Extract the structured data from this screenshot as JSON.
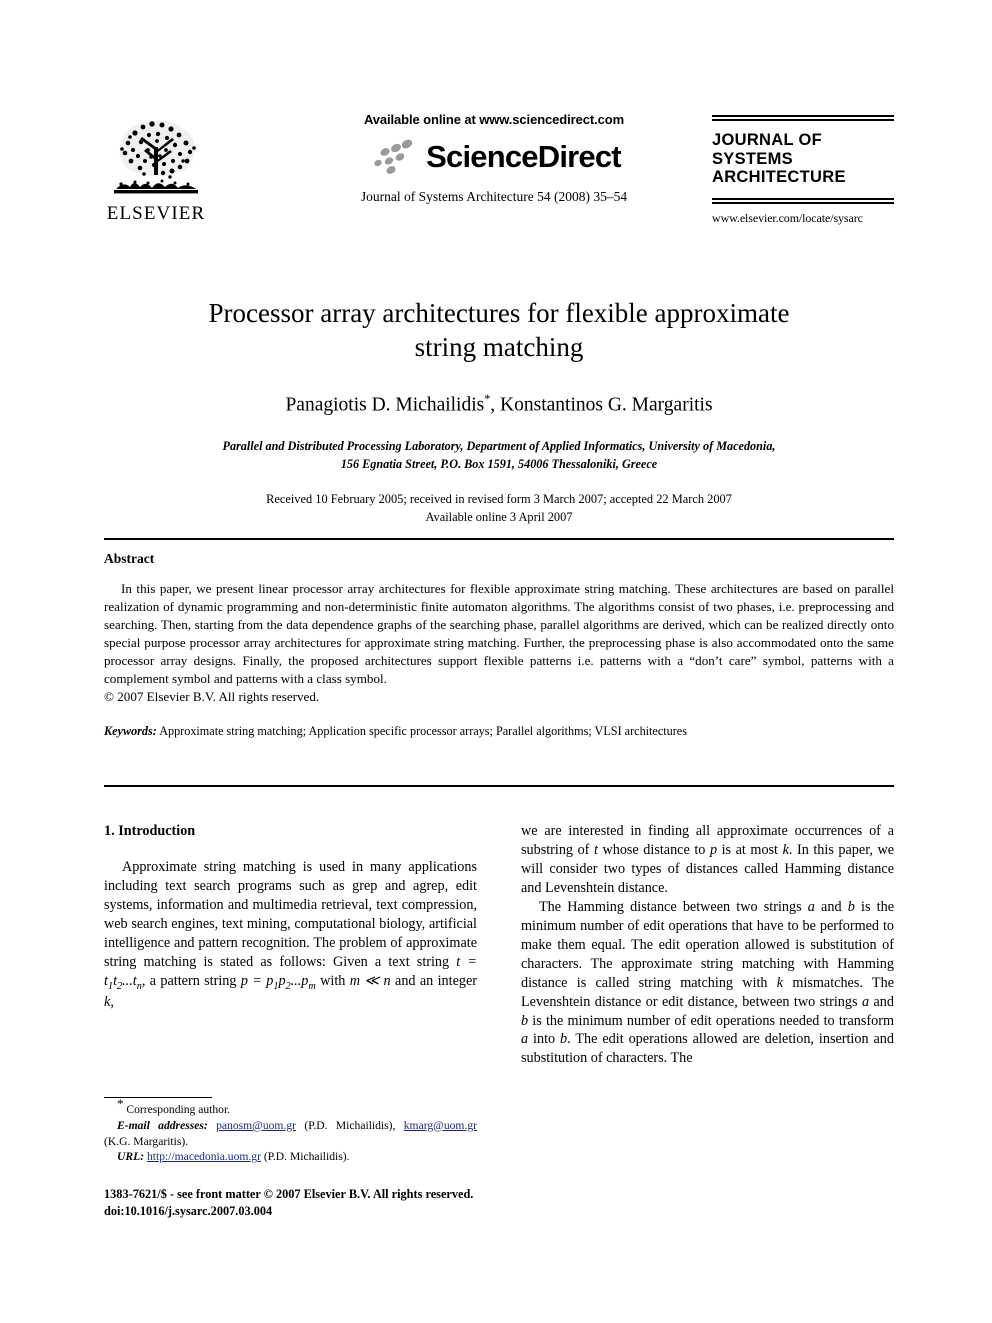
{
  "masthead": {
    "elsevier_wordmark": "ELSEVIER",
    "available_online": "Available online at www.sciencedirect.com",
    "sciencedirect_wordmark": "ScienceDirect",
    "journal_reference": "Journal of Systems Architecture 54 (2008) 35–54",
    "journal_title": "JOURNAL OF SYSTEMS ARCHITECTURE",
    "journal_homepage": "www.elsevier.com/locate/sysarc"
  },
  "title": {
    "line1": "Processor array architectures for flexible approximate",
    "line2": "string matching",
    "full": "Processor array architectures for flexible approximate string matching"
  },
  "authors": {
    "author1": "Panagiotis D. Michailidis",
    "corresponding_marker": "*",
    "separator": ", ",
    "author2": "Konstantinos G. Margaritis"
  },
  "affiliation": {
    "line1": "Parallel and Distributed Processing Laboratory, Department of Applied Informatics, University of Macedonia,",
    "line2": "156 Egnatia Street, P.O. Box 1591, 54006 Thessaloniki, Greece"
  },
  "dates": {
    "line1": "Received 10 February 2005; received in revised form 3 March 2007; accepted 22 March 2007",
    "line2": "Available online 3 April 2007"
  },
  "abstract": {
    "heading": "Abstract",
    "body": "In this paper, we present linear processor array architectures for flexible approximate string matching. These architectures are based on parallel realization of dynamic programming and non-deterministic finite automaton algorithms. The algorithms consist of two phases, i.e. preprocessing and searching. Then, starting from the data dependence graphs of the searching phase, parallel algorithms are derived, which can be realized directly onto special purpose processor array architectures for approximate string matching. Further, the preprocessing phase is also accommodated onto the same processor array designs. Finally, the proposed architectures support flexible patterns i.e. patterns with a “don’t care” symbol, patterns with a complement symbol and patterns with a class symbol.",
    "copyright": "© 2007 Elsevier B.V. All rights reserved."
  },
  "keywords": {
    "label": "Keywords:",
    "value": "Approximate string matching; Application specific processor arrays; Parallel algorithms; VLSI architectures"
  },
  "body": {
    "section_heading": "1. Introduction",
    "left_para1_a": "Approximate string matching is used in many applications including text search programs such as grep and agrep, edit systems, information and multimedia retrieval, text compression, web search engines, text mining, computational biology, artificial intelligence and pattern recognition. The problem of approximate string matching is stated as follows: Given a text string ",
    "left_para1_b": ", a pattern string ",
    "left_para1_c": " and an integer ",
    "left_para1_d": ",",
    "right_para1_a": "we are interested in finding all approximate occurrences of a substring of ",
    "right_para1_b": " whose distance to ",
    "right_para1_c": " is at most ",
    "right_para1_d": ". In this paper, we will consider two types of distances called Hamming distance and Levenshtein distance.",
    "right_para2_a": "The Hamming distance between two strings ",
    "right_para2_b": " and ",
    "right_para2_c": " is the minimum number of edit operations that have to be performed to make them equal. The edit operation allowed is substitution of characters. The approximate string matching with Hamming distance is called string matching with ",
    "right_para2_d": " mismatches. The Levenshtein distance or edit distance, between two strings ",
    "right_para2_e": " and ",
    "right_para2_f": " is the minimum number of edit operations needed to transform ",
    "right_para2_g": " into ",
    "right_para2_h": ". The edit operations allowed are deletion, insertion and substitution of characters. The"
  },
  "math": {
    "t_eq": "t = t",
    "t_sub1": "1",
    "t_mid": "t",
    "t_sub2": "2",
    "t_dots": "...t",
    "t_subn": "n",
    "p_eq": "p = p",
    "p_sub1": "1",
    "p_mid": "p",
    "p_sub2": "2",
    "p_dots": "...p",
    "p_subm": "m",
    "with": "with ",
    "m_ll_n": "m ≪ n",
    "k": "k",
    "t": "t",
    "p": "p",
    "a": "a",
    "b": "b"
  },
  "footnote": {
    "star": "*",
    "corresponding": " Corresponding author.",
    "email_label": "E-mail addresses:",
    "email1": "panosm@uom.gr",
    "email1_owner": "(P.D. Michailidis),",
    "email2": "kmarg@uom.gr",
    "email2_owner": "(K.G. Margaritis).",
    "url_label": "URL:",
    "url": "http://macedonia.uom.gr",
    "url_owner": "(P.D. Michailidis)."
  },
  "imprint": {
    "line1": "1383-7621/$ - see front matter © 2007 Elsevier B.V. All rights reserved.",
    "line2": "doi:10.1016/j.sysarc.2007.03.004"
  },
  "colors": {
    "text": "#000000",
    "link": "#1a2a7a",
    "background": "#ffffff",
    "sd_dots": "#9a9a9a"
  }
}
